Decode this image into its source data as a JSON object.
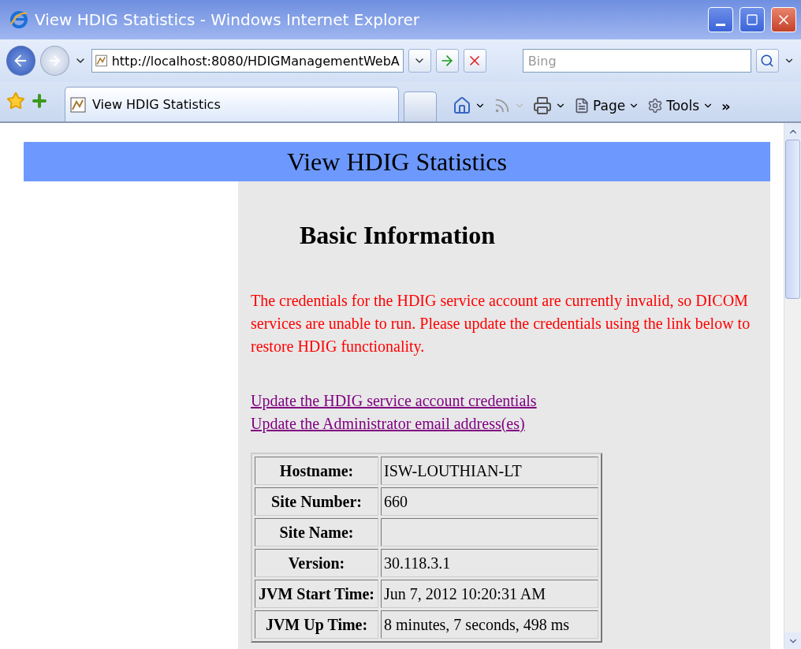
{
  "window": {
    "title": "View HDIG Statistics - Windows Internet Explorer"
  },
  "address_bar": {
    "url": "http://localhost:8080/HDIGManagementWebA"
  },
  "search": {
    "placeholder": "Bing"
  },
  "tabs": [
    {
      "title": "View HDIG Statistics",
      "selected": true
    }
  ],
  "command_bar": {
    "menus": [
      {
        "label": "Page"
      },
      {
        "label": "Tools"
      }
    ],
    "overflow": "»"
  },
  "page": {
    "banner": "View HDIG Statistics",
    "heading": "Basic Information",
    "warning": "The credentials for the HDIG service account are currently invalid, so DICOM services are unable to run. Please update the credentials using the link below to restore HDIG functionality.",
    "links": [
      "Update the HDIG service account credentials",
      "Update the Administrator email address(es)"
    ],
    "table": {
      "rows": [
        {
          "label": "Hostname:",
          "value": "ISW-LOUTHIAN-LT"
        },
        {
          "label": "Site Number:",
          "value": "660"
        },
        {
          "label": "Site Name:"
        },
        {
          "label": "Version:",
          "value": "30.118.3.1"
        },
        {
          "label": "JVM Start Time:",
          "value": "Jun 7, 2012 10:20:31 AM"
        },
        {
          "label": "JVM Up Time:",
          "value": "8 minutes, 7 seconds, 498 ms"
        }
      ]
    }
  }
}
